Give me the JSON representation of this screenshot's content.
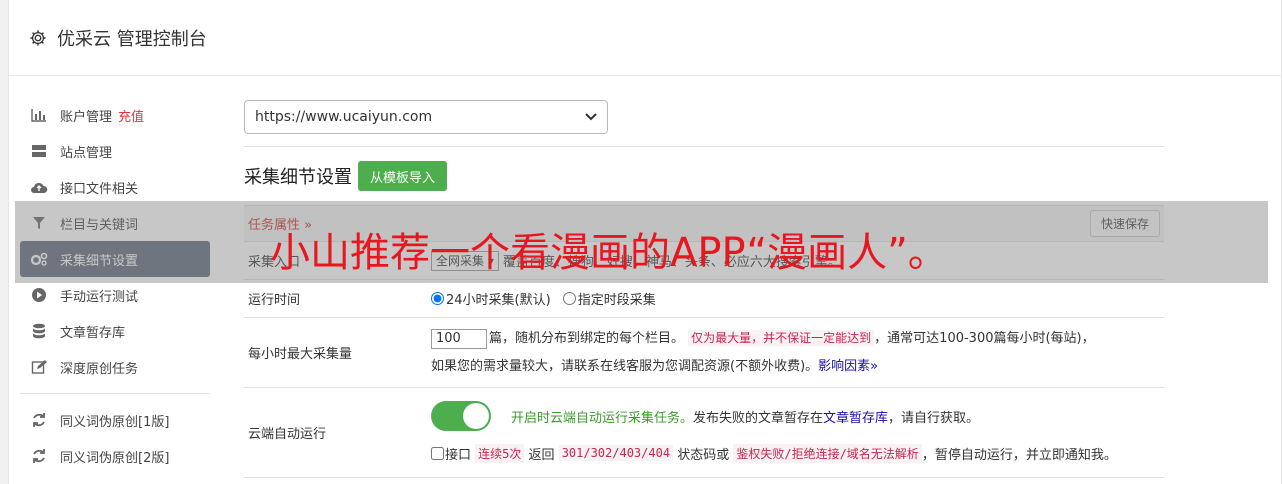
{
  "header": {
    "title": "优采云 管理控制台"
  },
  "sidebar": {
    "items": [
      {
        "label": "账户管理",
        "tag": "充值",
        "icon": "bar-chart-icon"
      },
      {
        "label": "站点管理",
        "icon": "server-icon"
      },
      {
        "label": "接口文件相关",
        "icon": "cloud-upload-icon"
      },
      {
        "label": "栏目与关键词",
        "icon": "filter-icon"
      },
      {
        "label": "采集细节设置",
        "icon": "cogs-icon",
        "active": true
      },
      {
        "label": "手动运行测试",
        "icon": "play-circle-icon"
      },
      {
        "label": "文章暂存库",
        "icon": "database-icon"
      },
      {
        "label": "深度原创任务",
        "icon": "edit-icon"
      },
      {
        "label": "同义词伪原创[1版]",
        "icon": "refresh-icon"
      },
      {
        "label": "同义词伪原创[2版]",
        "icon": "refresh-icon"
      }
    ]
  },
  "site_select": {
    "value": "https://www.ucaiyun.com"
  },
  "section": {
    "title": "采集细节设置",
    "import_button": "从模板导入"
  },
  "table": {
    "head_label": "任务属性 »",
    "save_button": "快速保存",
    "entry": {
      "label": "采集入口",
      "select_value": "全网采集",
      "desc": "覆盖百度、搜狗、好搜、神马、头条、必应六大搜索引擎。"
    },
    "runtime": {
      "label": "运行时间",
      "option1": "24小时采集(默认)",
      "option2": "指定时段采集"
    },
    "max_per_hour": {
      "label": "每小时最大采集量",
      "value": "100",
      "text1": "篇，随机分布到绑定的每个栏目。",
      "note": "仅为最大量，并不保证一定能达到",
      "text2": "，通常可达100-300篇每小时(每站)，",
      "text3": "如果您的需求量较大，请联系在线客服为您调配资源(不额外收费)。",
      "link": "影响因素»"
    },
    "cloud_run": {
      "label": "云端自动运行",
      "enabled_text": "开启时云端自动运行采集任务。",
      "text1": "发布失败的文章暂存在",
      "link": "文章暂存库",
      "text2": "，请自行获取。",
      "check_label": "接口",
      "note1": "连续5次",
      "text3": "返回",
      "note2": "301/302/403/404",
      "text4": "状态码或",
      "note3": "鉴权失败/拒绝连接/域名无法解析",
      "text5": "，暂停自动运行，并立即通知我。"
    }
  },
  "overlay": {
    "text": "小山推荐一个看漫画的APP“漫画人”。"
  },
  "colors": {
    "accent_green": "#4cae4c",
    "active_nav": "#5f6b7a",
    "overlay_red": "#e8161f"
  }
}
